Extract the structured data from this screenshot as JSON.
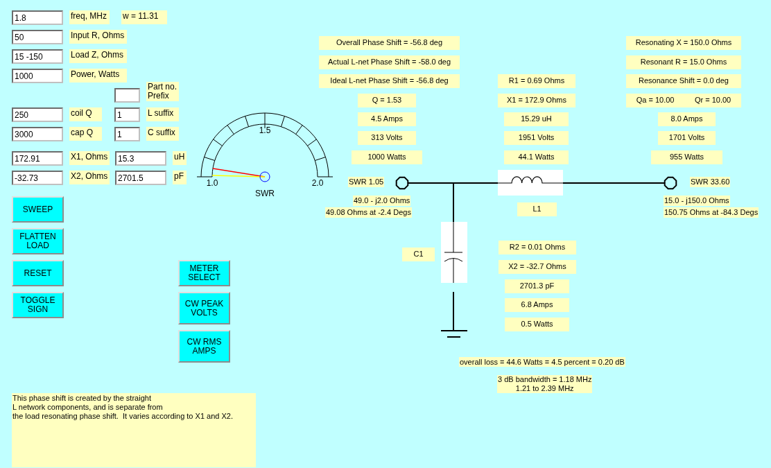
{
  "settings": [
    {
      "value": "1.8",
      "label": "freq, MHz",
      "note": "w = 11.31"
    },
    {
      "value": "50",
      "label": "Input R, Ohms"
    },
    {
      "value": "15 -150",
      "label": "Load Z, Ohms"
    },
    {
      "value": "1000",
      "label": "Power, Watts"
    }
  ],
  "part_prefix": {
    "label": "Part no.\nPrefix"
  },
  "quality": [
    {
      "value": "250",
      "label": "coil Q",
      "suffix_value": "1",
      "suffix_label": "L suffix"
    },
    {
      "value": "3000",
      "label": "cap Q",
      "suffix_value": "1",
      "suffix_label": "C suffix"
    }
  ],
  "reactances": [
    {
      "value": "172.91",
      "label": "X1, Ohms",
      "part_value": "15.3",
      "unit": "uH"
    },
    {
      "value": "-32.73",
      "label": "X2, Ohms",
      "part_value": "2701.5",
      "unit": "pF"
    }
  ],
  "buttons": [
    "SWEEP",
    "FLATTEN LOAD",
    "RESET",
    "TOGGLE SIGN"
  ],
  "meter_buttons": [
    "METER SELECT",
    "CW PEAK VOLTS",
    "CW RMS AMPS"
  ],
  "meter": {
    "scale_min": "1.0",
    "scale_mid": "1.5",
    "scale_max": "2.0",
    "caption": "SWR",
    "needles": [
      {
        "color": "#ff0000"
      },
      {
        "color": "#ffff00"
      }
    ]
  },
  "help_text": "This phase shift is created by the straight\nL network components, and is separate from\nthe load resonating phase shift.  It varies according to X1 and X2.",
  "input_side": {
    "readouts": [
      "Overall Phase Shift = -56.8 deg",
      "Actual L-net Phase Shift = -58.0 deg",
      "Ideal L-net Phase Shift = -56.8 deg",
      "Q = 1.53",
      "4.5 Amps",
      "313 Volts",
      "1000 Watts"
    ],
    "swr": "SWR 1.05",
    "impedance": "49.0 - j2.0 Ohms",
    "polar": "49.08 Ohms at -2.4 Degs"
  },
  "inductor": {
    "name": "L1",
    "readouts": [
      "R1 = 0.69 Ohms",
      "X1 = 172.9 Ohms",
      "15.29 uH",
      "1951 Volts",
      "44.1 Watts"
    ]
  },
  "load_side": {
    "readouts": [
      "Resonating X = 150.0 Ohms",
      "Resonant R = 15.0 Ohms",
      "Resonance Shift = 0.0 deg"
    ],
    "q_values": [
      "Qa = 10.00",
      "Qr = 10.00"
    ],
    "currents": [
      "8.0 Amps",
      "1701 Volts",
      "955 Watts"
    ],
    "swr": "SWR 33.60",
    "impedance": "15.0 - j150.0 Ohms",
    "polar": "150.75 Ohms at -84.3 Degs"
  },
  "capacitor": {
    "name": "C1",
    "readouts": [
      "R2 = 0.01 Ohms",
      "X2 = -32.7 Ohms",
      "2701.3 pF",
      "6.8 Amps",
      "0.5 Watts"
    ]
  },
  "summary": {
    "loss": "overall loss = 44.6 Watts = 4.5 percent = 0.20 dB",
    "bandwidth": "3 dB bandwidth = 1.18 MHz\n1.21 to 2.39 MHz"
  }
}
